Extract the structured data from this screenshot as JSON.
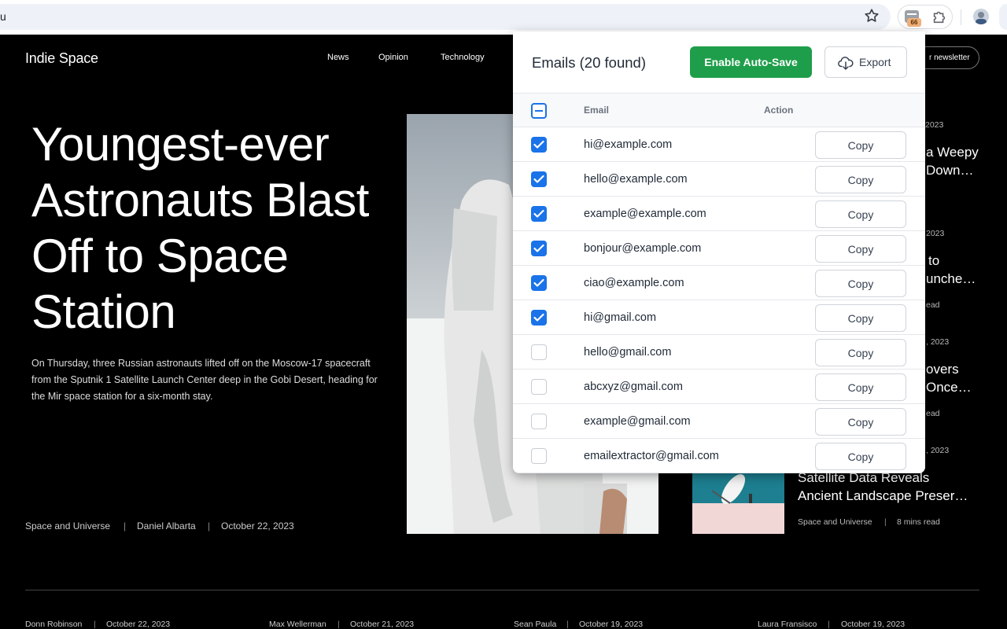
{
  "browser": {
    "url_fragment": "u",
    "extension_badge": "66"
  },
  "site": {
    "logo": "Indie Space",
    "nav": [
      "News",
      "Opinion",
      "Technology"
    ],
    "newsletter_label": "r newsletter",
    "headline": "Youngest-ever Astronauts Blast Off to Space Station",
    "lede": "On Thursday, three Russian astronauts lifted off on the Moscow-17 spacecraft from the Sputnik 1 Satellite Launch Center deep in the Gobi Desert, heading for the Mir space station for a six-month stay.",
    "meta": {
      "category": "Space and Universe",
      "author": "Daniel Albarta",
      "date": "October 22, 2023"
    },
    "side": {
      "items": [
        {
          "date": "2023",
          "title1": "a Weepy",
          "title2": "Down…",
          "meta": ""
        },
        {
          "date": "2023",
          "title1": "to",
          "title2": "unche…",
          "meta": "ead"
        },
        {
          "date": ", 2023",
          "title1": "overs",
          "title2": "Once…",
          "meta": "ead"
        },
        {
          "date": ", 2023",
          "title1": "Satellite Data Reveals",
          "title2": "Ancient Landscape Preser…",
          "meta": "Space and Universe"
        }
      ],
      "last_read_time": "8 mins read"
    },
    "footer": [
      {
        "author": "Donn Robinson",
        "date": "October 22, 2023"
      },
      {
        "author": "Max Wellerman",
        "date": "October 21, 2023"
      },
      {
        "author": "Sean Paula",
        "date": "October 19, 2023"
      },
      {
        "author": "Laura Fransisco",
        "date": "October 19, 2023"
      }
    ]
  },
  "popup": {
    "title": "Emails (20 found)",
    "save_label": "Enable Auto-Save",
    "export_label": "Export",
    "col_email": "Email",
    "col_action": "Action",
    "copy_label": "Copy",
    "rows": [
      {
        "email": "hi@example.com",
        "checked": true
      },
      {
        "email": "hello@example.com",
        "checked": true
      },
      {
        "email": "example@example.com",
        "checked": true
      },
      {
        "email": "bonjour@example.com",
        "checked": true
      },
      {
        "email": "ciao@example.com",
        "checked": true
      },
      {
        "email": "hi@gmail.com",
        "checked": true
      },
      {
        "email": "hello@gmail.com",
        "checked": false
      },
      {
        "email": "abcxyz@gmail.com",
        "checked": false
      },
      {
        "email": "example@gmail.com",
        "checked": false
      },
      {
        "email": "emailextractor@gmail.com",
        "checked": false
      }
    ]
  },
  "icons": {
    "star": "star-icon",
    "extension": "email-extractor-icon",
    "puzzle": "puzzle-icon",
    "export": "cloud-download-icon",
    "check": "check-icon"
  },
  "colors": {
    "accent_green": "#1e9e4a",
    "checkbox_blue": "#1a73e8"
  }
}
